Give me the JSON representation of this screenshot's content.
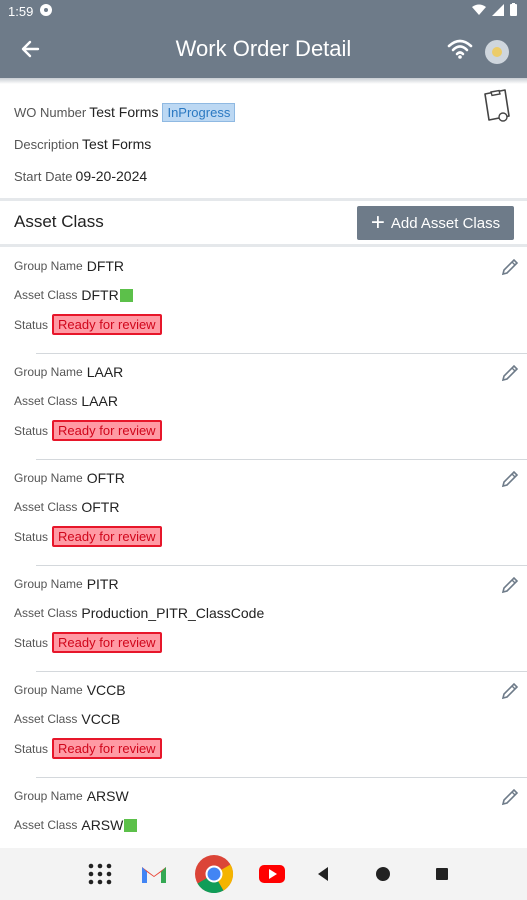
{
  "status_bar": {
    "time": "1:59"
  },
  "app_bar": {
    "title": "Work Order Detail"
  },
  "work_order": {
    "wo_number_label": "WO Number",
    "wo_number": "Test Forms",
    "status": "InProgress",
    "description_label": "Description",
    "description": "Test Forms",
    "start_date_label": "Start Date",
    "start_date": "09-20-2024"
  },
  "asset_section": {
    "title": "Asset Class",
    "add_button": "Add Asset Class",
    "labels": {
      "group": "Group Name",
      "asset": "Asset Class",
      "status": "Status"
    },
    "items": [
      {
        "group": "DFTR",
        "asset": "DFTR",
        "status": "Ready for review"
      },
      {
        "group": "LAAR",
        "asset": "LAAR",
        "status": "Ready for review"
      },
      {
        "group": "OFTR",
        "asset": "OFTR",
        "status": "Ready for review"
      },
      {
        "group": "PITR",
        "asset": "Production_PITR_ClassCode",
        "status": "Ready for review"
      },
      {
        "group": "VCCB",
        "asset": "VCCB",
        "status": "Ready for review"
      },
      {
        "group": "ARSW",
        "asset": "ARSW",
        "status": ""
      }
    ]
  },
  "colors": {
    "app_bar": "#6e7b89",
    "status_badge_bg": "#ff9aa4",
    "status_badge_text": "#d0061b",
    "inprogress_bg": "#bcd8f3"
  }
}
